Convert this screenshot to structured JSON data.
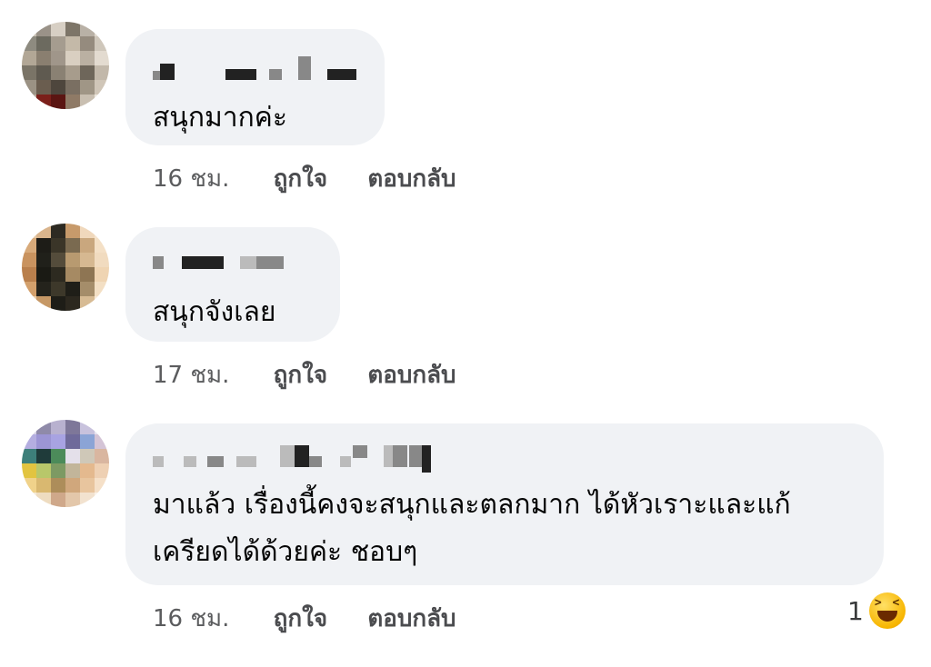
{
  "comments": [
    {
      "text": "สนุกมากค่ะ",
      "time": "16 ชม.",
      "like_label": "ถูกใจ",
      "reply_label": "ตอบกลับ"
    },
    {
      "text": "สนุกจังเลย",
      "time": "17 ชม.",
      "like_label": "ถูกใจ",
      "reply_label": "ตอบกลับ"
    },
    {
      "text_line1": "มาแล้ว เรื่องนี้คงจะสนุกและตลกมาก ได้หัวเราะและแก้",
      "text_line2": "เครียดได้ด้วยค่ะ ชอบๆ",
      "time": "16 ชม.",
      "like_label": "ถูกใจ",
      "reply_label": "ตอบกลับ",
      "reaction_count": "1",
      "reaction_icon": "laughing-emoji-icon"
    }
  ]
}
